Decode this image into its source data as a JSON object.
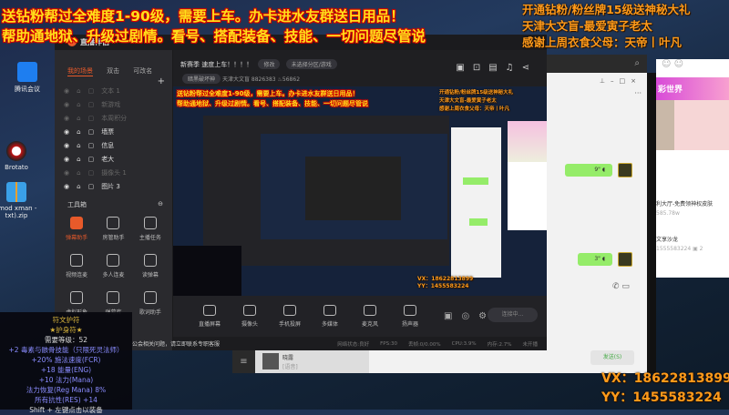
{
  "overlay": {
    "banner_lines": [
      "送钻粉帮过全难度1-90级，需要上车。办卡进水友群送日用品！",
      "帮助通地狱、升级过剧情。看号、搭配装备、技能、一切问题尽管说"
    ],
    "right_lines": [
      "开通钻粉/粉丝牌15级送神秘大礼",
      "天津大文盲-最爱寅子老太",
      "感谢上周衣食父母：天帝丨叶凡"
    ],
    "contact_vx": "VX：18622813899",
    "contact_yy": "YY：1455583224"
  },
  "desktop": {
    "icons": [
      {
        "label": "腾讯会议"
      },
      {
        "label": "Brotato"
      },
      {
        "label": "-mod xman -txt).zip"
      }
    ]
  },
  "app": {
    "brand": "直播伴侣",
    "tabs": [
      {
        "label": "我的场景"
      },
      {
        "label": "双击"
      },
      {
        "label": "可改名"
      }
    ],
    "add": "+",
    "scenes": [
      {
        "label": "文本 1",
        "on": false
      },
      {
        "label": "新游戏",
        "on": false
      },
      {
        "label": "本周积分",
        "on": false
      },
      {
        "label": "墙票",
        "on": true
      },
      {
        "label": "信息",
        "on": true
      },
      {
        "label": "老大",
        "on": true
      },
      {
        "label": "摄像头 1",
        "on": false
      },
      {
        "label": "图片 3",
        "on": true
      }
    ],
    "toolbox_title": "工具箱",
    "tools": [
      {
        "label": "弹幕助手"
      },
      {
        "label": "房管助手"
      },
      {
        "label": "主播任务"
      },
      {
        "label": "视频连麦"
      },
      {
        "label": "多人连麦"
      },
      {
        "label": "读弹幕"
      },
      {
        "label": "虚拟形象"
      },
      {
        "label": "弹幕库"
      },
      {
        "label": "歌词助手"
      }
    ],
    "header": {
      "title": "新赛季 速度上车！！！！",
      "edit": "修改",
      "category": "未选择分区/游戏",
      "tag": "暗黑破坏神",
      "name": "天津大文盲",
      "id": "8826383",
      "heat": "56862"
    },
    "controls": [
      {
        "label": "直播屏幕"
      },
      {
        "label": "摄像头"
      },
      {
        "label": "手机投屏"
      },
      {
        "label": "多媒体"
      },
      {
        "label": "麦克风"
      },
      {
        "label": "扬声器"
      }
    ],
    "start_button": "连接中...",
    "status": [
      "网络状态:良好",
      "FPS:30",
      "丢帧:0/0.00%",
      "CPU:3.9%",
      "内存:2.7%",
      "未开播"
    ],
    "notice": "公会相关问题，请立即联系专职客服"
  },
  "chat": {
    "bubbles": [
      "9\"",
      "3\""
    ],
    "send": "发送(S)",
    "contact_name": "晓露",
    "contact_sub": "[语音]"
  },
  "live_list": {
    "banner": "彩世界",
    "items": [
      {
        "title": "利大厅-免费领神权皮肤",
        "sub": "585.78w"
      },
      {
        "title": "文享沙龙",
        "sub": "1555583224",
        "count": "2"
      }
    ]
  },
  "tooltip": {
    "title": "符文护符",
    "subtitle": "★护身符★",
    "lines": [
      {
        "t": "需要等级：52",
        "c": "white"
      },
      {
        "t": "+2 毒素与骸骨技能（只限死灵法师）",
        "c": "blue"
      },
      {
        "t": "+20% 施法速度(FCR)",
        "c": "blue"
      },
      {
        "t": "+18 能量(ENG)",
        "c": "blue"
      },
      {
        "t": "+10 法力(Mana)",
        "c": "blue"
      },
      {
        "t": "法力恢复(Reg Mana) 8%",
        "c": "blue"
      },
      {
        "t": "所有抗性(RES) +14",
        "c": "blue"
      },
      {
        "t": "Shift + 左键点击以装备",
        "c": "white"
      }
    ]
  }
}
